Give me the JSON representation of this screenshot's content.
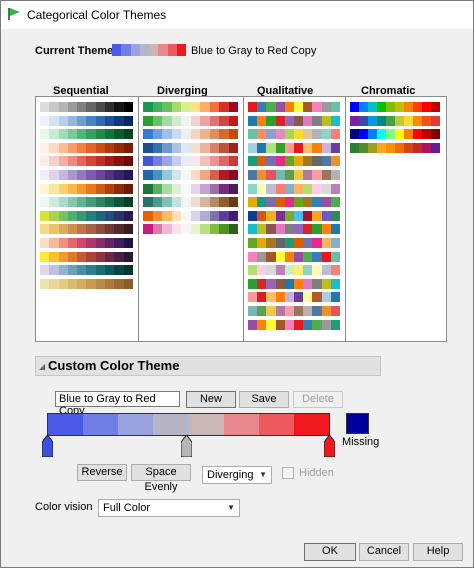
{
  "window": {
    "title": "Categorical Color Themes"
  },
  "current_theme": {
    "label": "Current Theme",
    "name": "Blue to Gray to Red Copy",
    "colors": [
      "#4a59e6",
      "#6f7fe6",
      "#9aa3dd",
      "#b4b6c8",
      "#c9b7b8",
      "#e8888c",
      "#ec5a5e",
      "#f0181f"
    ]
  },
  "gallery": {
    "columns": [
      {
        "name": "Sequential",
        "themes": [
          [
            "#dcdcdc",
            "#c8c8c8",
            "#b4b4b4",
            "#9a9a9a",
            "#808080",
            "#656565",
            "#4a4a4a",
            "#2e2e2e",
            "#141414",
            "#000000"
          ],
          [
            "#eef3fa",
            "#d4e2f3",
            "#b6cfe9",
            "#93b8de",
            "#6e9fd1",
            "#4c84c2",
            "#3269ae",
            "#1f5096",
            "#103a7a",
            "#062660"
          ],
          [
            "#e7f6ec",
            "#c8ebd4",
            "#a2dcb7",
            "#78ca97",
            "#51b67a",
            "#35a160",
            "#208a4b",
            "#12733a",
            "#075c2b",
            "#00451e"
          ],
          [
            "#fff0e6",
            "#fdd9c0",
            "#fbbd94",
            "#f79e69",
            "#f27f44",
            "#e56428",
            "#cf4c13",
            "#b33a0b",
            "#942b05",
            "#741f02"
          ],
          [
            "#fdecea",
            "#f9cfc9",
            "#f3aea5",
            "#ec8a80",
            "#e1675d",
            "#d3463e",
            "#bf2d27",
            "#a61b18",
            "#88100e",
            "#6a0807"
          ],
          [
            "#f3eff8",
            "#ddd3ec",
            "#c5b5df",
            "#ab96d0",
            "#9278c1",
            "#7a5daf",
            "#65469b",
            "#503385",
            "#3c226e",
            "#281456"
          ],
          [
            "#fff5cc",
            "#fde69b",
            "#fcd16b",
            "#f9b845",
            "#f39a2a",
            "#e7791a",
            "#d05a12",
            "#b2400d",
            "#902b08",
            "#6c1a04"
          ],
          [
            "#edf7f3",
            "#cfe9df",
            "#abd9c8",
            "#85c7ae",
            "#60b493",
            "#429e79",
            "#2d8662",
            "#1b6e4e",
            "#0e573b",
            "#04402a"
          ],
          [
            "#d8e03a",
            "#a9d24c",
            "#7ac25c",
            "#52ae6a",
            "#369874",
            "#237f7a",
            "#1d667c",
            "#234c78",
            "#2b336b",
            "#2b1a55"
          ],
          [
            "#f7d98c",
            "#eec26d",
            "#e0a85a",
            "#cf8f4f",
            "#bb7748",
            "#a46143",
            "#8a4d3d",
            "#6e3b35",
            "#532b2b",
            "#391c1f"
          ],
          [
            "#fbe0c4",
            "#f7b999",
            "#ef8f7e",
            "#e2666f",
            "#cc4a6c",
            "#ac386d",
            "#8a2c6c",
            "#652466",
            "#421c5b",
            "#1f114a"
          ],
          [
            "#ffe93a",
            "#f6c22b",
            "#ec9c2a",
            "#de7a2e",
            "#ca5a35",
            "#b03f3c",
            "#903040",
            "#6c2742",
            "#492040",
            "#28173a"
          ],
          [
            "#e0d8f0",
            "#bbc3e2",
            "#94b1d0",
            "#6e9fbd",
            "#4d8ea7",
            "#317d90",
            "#1d6b78",
            "#10595f",
            "#084647",
            "#033431"
          ],
          [
            "#efe3b3",
            "#e9d79a",
            "#e3c983",
            "#dbba70",
            "#d2aa60",
            "#c79952",
            "#bb8946",
            "#ad793c",
            "#9e6a33",
            "#8e5c2b"
          ]
        ]
      },
      {
        "name": "Diverging",
        "themes": [
          [
            "#1a9850",
            "#3bb25e",
            "#66bd63",
            "#a6d96a",
            "#d9ef8b",
            "#fee08b",
            "#fdae61",
            "#f46d43",
            "#d73027",
            "#a50026"
          ],
          [
            "#2ca02c",
            "#66c266",
            "#a3d9a3",
            "#d0ecd0",
            "#f2f2f2",
            "#f7d0d0",
            "#eda3a3",
            "#e07373",
            "#d44444",
            "#c41a1a"
          ],
          [
            "#3a7bd5",
            "#6c9de0",
            "#9dbfea",
            "#c9dbf3",
            "#eeeeee",
            "#f4d6c4",
            "#ebb490",
            "#e08f5c",
            "#d46a2c",
            "#c54a07"
          ],
          [
            "#1c4f8c",
            "#3670ae",
            "#6b9acb",
            "#a8c4e3",
            "#dde8f3",
            "#f4dfd4",
            "#eab49c",
            "#d9826a",
            "#c1503f",
            "#a3201f"
          ],
          [
            "#4455d2",
            "#6f7ee0",
            "#9ba6ea",
            "#c6cbf2",
            "#ebecf7",
            "#f7e9e9",
            "#f2c0c1",
            "#ea9495",
            "#df6668",
            "#d1373a"
          ],
          [
            "#2166ac",
            "#4393c3",
            "#92c5de",
            "#d1e5f0",
            "#f7f7f7",
            "#fddbc7",
            "#f4a582",
            "#d6604d",
            "#b2182b",
            "#8b0a24"
          ],
          [
            "#1b7837",
            "#5aae61",
            "#a6dba0",
            "#d9f0d3",
            "#f7f7f7",
            "#e7d4e8",
            "#c2a5cf",
            "#9970ab",
            "#762a83",
            "#4f1a5c"
          ],
          [
            "#27736d",
            "#4a9a90",
            "#80c1b4",
            "#c0e4da",
            "#f3f3f3",
            "#ebddd0",
            "#d4b69a",
            "#b68a63",
            "#905d35",
            "#6a3a17"
          ],
          [
            "#e66101",
            "#f08d3b",
            "#fdb863",
            "#fde0b7",
            "#f7f7f7",
            "#d8d5ea",
            "#b2abd2",
            "#8073ac",
            "#5e3c99",
            "#3f1d7a"
          ],
          [
            "#c51b7d",
            "#de77ae",
            "#f1b6da",
            "#fde0ef",
            "#f7f7f7",
            "#e6f5d0",
            "#b8e186",
            "#7fbc41",
            "#4d9221",
            "#276419"
          ]
        ]
      },
      {
        "name": "Qualitative",
        "themes": [
          [
            "#e41a1c",
            "#377eb8",
            "#4daf4a",
            "#984ea3",
            "#ff7f00",
            "#ffff33",
            "#a65628",
            "#f781bf",
            "#999999",
            "#66c2a5"
          ],
          [
            "#1f77b4",
            "#ff7f0e",
            "#2ca02c",
            "#d62728",
            "#9467bd",
            "#8c564b",
            "#e377c2",
            "#7f7f7f",
            "#bcbd22",
            "#17becf"
          ],
          [
            "#66c2a5",
            "#fc8d62",
            "#8da0cb",
            "#e78ac3",
            "#a6d854",
            "#ffd92f",
            "#e5c494",
            "#b3b3b3",
            "#8dd3c7",
            "#fb8072"
          ],
          [
            "#a6cee3",
            "#1f78b4",
            "#b2df8a",
            "#33a02c",
            "#fb9a99",
            "#e31a1c",
            "#fdbf6f",
            "#ff7f00",
            "#cab2d6",
            "#6a3d9a"
          ],
          [
            "#1b9e77",
            "#d95f02",
            "#7570b3",
            "#e7298a",
            "#66a61e",
            "#e6ab02",
            "#a6761d",
            "#666666",
            "#4e79a7",
            "#f28e2b"
          ],
          [
            "#4e79a7",
            "#f28e2b",
            "#e15759",
            "#76b7b2",
            "#59a14f",
            "#edc948",
            "#b07aa1",
            "#ff9da7",
            "#9c755f",
            "#bab0ac"
          ],
          [
            "#8dd3c7",
            "#ffffb3",
            "#bebada",
            "#fb8072",
            "#80b1d3",
            "#fdb462",
            "#b3de69",
            "#fccde5",
            "#d9d9d9",
            "#bc80bd"
          ],
          [
            "#e6ab02",
            "#1b9e77",
            "#7570b3",
            "#d95f02",
            "#e7298a",
            "#66a61e",
            "#a6761d",
            "#377eb8",
            "#984ea3",
            "#4daf4a"
          ],
          [
            "#0b3d91",
            "#d95319",
            "#edb120",
            "#7e2f8e",
            "#77ac30",
            "#4dbeee",
            "#a2142f",
            "#f5a623",
            "#6a5acd",
            "#2e8b57"
          ],
          [
            "#17becf",
            "#bcbd22",
            "#8c564b",
            "#e377c2",
            "#7f7f7f",
            "#9467bd",
            "#d62728",
            "#2ca02c",
            "#ff7f0e",
            "#1f77b4"
          ],
          [
            "#66a61e",
            "#e6ab02",
            "#a6761d",
            "#666666",
            "#1b9e77",
            "#d95f02",
            "#7570b3",
            "#e7298a",
            "#fdb462",
            "#80b1d3"
          ],
          [
            "#f781bf",
            "#999999",
            "#a65628",
            "#ffff33",
            "#ff7f00",
            "#984ea3",
            "#4daf4a",
            "#377eb8",
            "#e41a1c",
            "#66c2a5"
          ],
          [
            "#b3de69",
            "#fccde5",
            "#d9d9d9",
            "#bc80bd",
            "#ccebc5",
            "#ffed6f",
            "#8dd3c7",
            "#ffffb3",
            "#bebada",
            "#fb8072"
          ],
          [
            "#2ca02c",
            "#d62728",
            "#9467bd",
            "#8c564b",
            "#1f77b4",
            "#ff7f0e",
            "#e377c2",
            "#7f7f7f",
            "#bcbd22",
            "#17becf"
          ],
          [
            "#fb9a99",
            "#e31a1c",
            "#fdbf6f",
            "#ff7f00",
            "#cab2d6",
            "#6a3d9a",
            "#ffff99",
            "#b15928",
            "#a6cee3",
            "#1f78b4"
          ],
          [
            "#76b7b2",
            "#59a14f",
            "#edc948",
            "#b07aa1",
            "#ff9da7",
            "#9c755f",
            "#bab0ac",
            "#4e79a7",
            "#f28e2b",
            "#e15759"
          ],
          [
            "#984ea3",
            "#ff7f00",
            "#ffff33",
            "#a65628",
            "#f781bf",
            "#e41a1c",
            "#377eb8",
            "#4daf4a",
            "#999999",
            "#1b9e77"
          ]
        ]
      },
      {
        "name": "Chromatic",
        "themes": [
          [
            "#0000ff",
            "#0080ff",
            "#00c0c0",
            "#00c000",
            "#80c000",
            "#c0c000",
            "#ff8000",
            "#ff4000",
            "#ff0000",
            "#c00000"
          ],
          [
            "#7b1fa2",
            "#3949ab",
            "#039be5",
            "#00897b",
            "#43a047",
            "#c0ca33",
            "#fdd835",
            "#fb8c00",
            "#f4511e",
            "#e53935"
          ],
          [
            "#00007f",
            "#0000ff",
            "#007fff",
            "#00ffff",
            "#7fff7f",
            "#ffff00",
            "#ff7f00",
            "#ff0000",
            "#c00000",
            "#7f0000"
          ],
          [
            "#2e7d32",
            "#558b2f",
            "#9e9d24",
            "#f9a825",
            "#ff8f00",
            "#ef6c00",
            "#d84315",
            "#c62828",
            "#ad1457",
            "#6a1b9a"
          ]
        ]
      }
    ]
  },
  "custom": {
    "section_title": "Custom Color Theme",
    "name_value": "Blue to Gray to Red Copy",
    "new_label": "New",
    "save_label": "Save",
    "delete_label": "Delete",
    "gradient_colors": [
      "#4a59e6",
      "#6f7fe6",
      "#9aa3dd",
      "#b4b6c8",
      "#c9b7b8",
      "#e8888c",
      "#ec5a5e",
      "#f0181f"
    ],
    "handle_colors": {
      "left": "#3a4fe0",
      "middle": "#b5b5b5",
      "right": "#f0181f"
    },
    "missing_color": "#0000a0",
    "missing_label": "Missing",
    "reverse_label": "Reverse",
    "space_evenly_label": "Space Evenly",
    "type_value": "Diverging",
    "hidden_label": "Hidden"
  },
  "color_vision": {
    "label": "Color vision",
    "value": "Full Color"
  },
  "footer": {
    "ok_label": "OK",
    "cancel_label": "Cancel",
    "help_label": "Help"
  }
}
